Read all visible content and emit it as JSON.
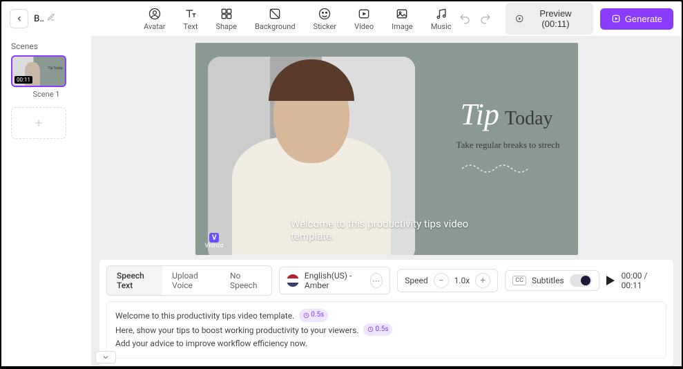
{
  "header": {
    "title": "B...",
    "tools": [
      {
        "id": "avatar",
        "label": "Avatar"
      },
      {
        "id": "text",
        "label": "Text"
      },
      {
        "id": "shape",
        "label": "Shape"
      },
      {
        "id": "background",
        "label": "Background"
      },
      {
        "id": "sticker",
        "label": "Sticker"
      },
      {
        "id": "video",
        "label": "Video"
      },
      {
        "id": "image",
        "label": "Image"
      },
      {
        "id": "music",
        "label": "Music"
      }
    ],
    "preview_label": "Preview (00:11)",
    "generate_label": "Generate"
  },
  "sidebar": {
    "title": "Scenes",
    "scenes": [
      {
        "label": "Scene 1",
        "duration": "00:11"
      }
    ]
  },
  "canvas": {
    "tip_script": "Tip",
    "tip_today": "Today",
    "tip_sub": "Take regular breaks to strech",
    "caption": "Welcome to this productivity tips video template.",
    "watermark": "Vidnoz"
  },
  "controls": {
    "tabs": [
      "Speech Text",
      "Upload Voice",
      "No Speech"
    ],
    "language": "English(US) - Amber",
    "speed_label": "Speed",
    "speed_value": "1.0x",
    "subtitle_label": "Subtitles",
    "time_current": "00:00",
    "time_total": "00:11"
  },
  "script": {
    "line1": "Welcome to this productivity tips video template.",
    "chip1": "0.5s",
    "line2": "Here, show your tips to boost working productivity to your viewers.",
    "chip2": "0.5s",
    "line3": "Add your advice to improve workflow efficiency now."
  }
}
